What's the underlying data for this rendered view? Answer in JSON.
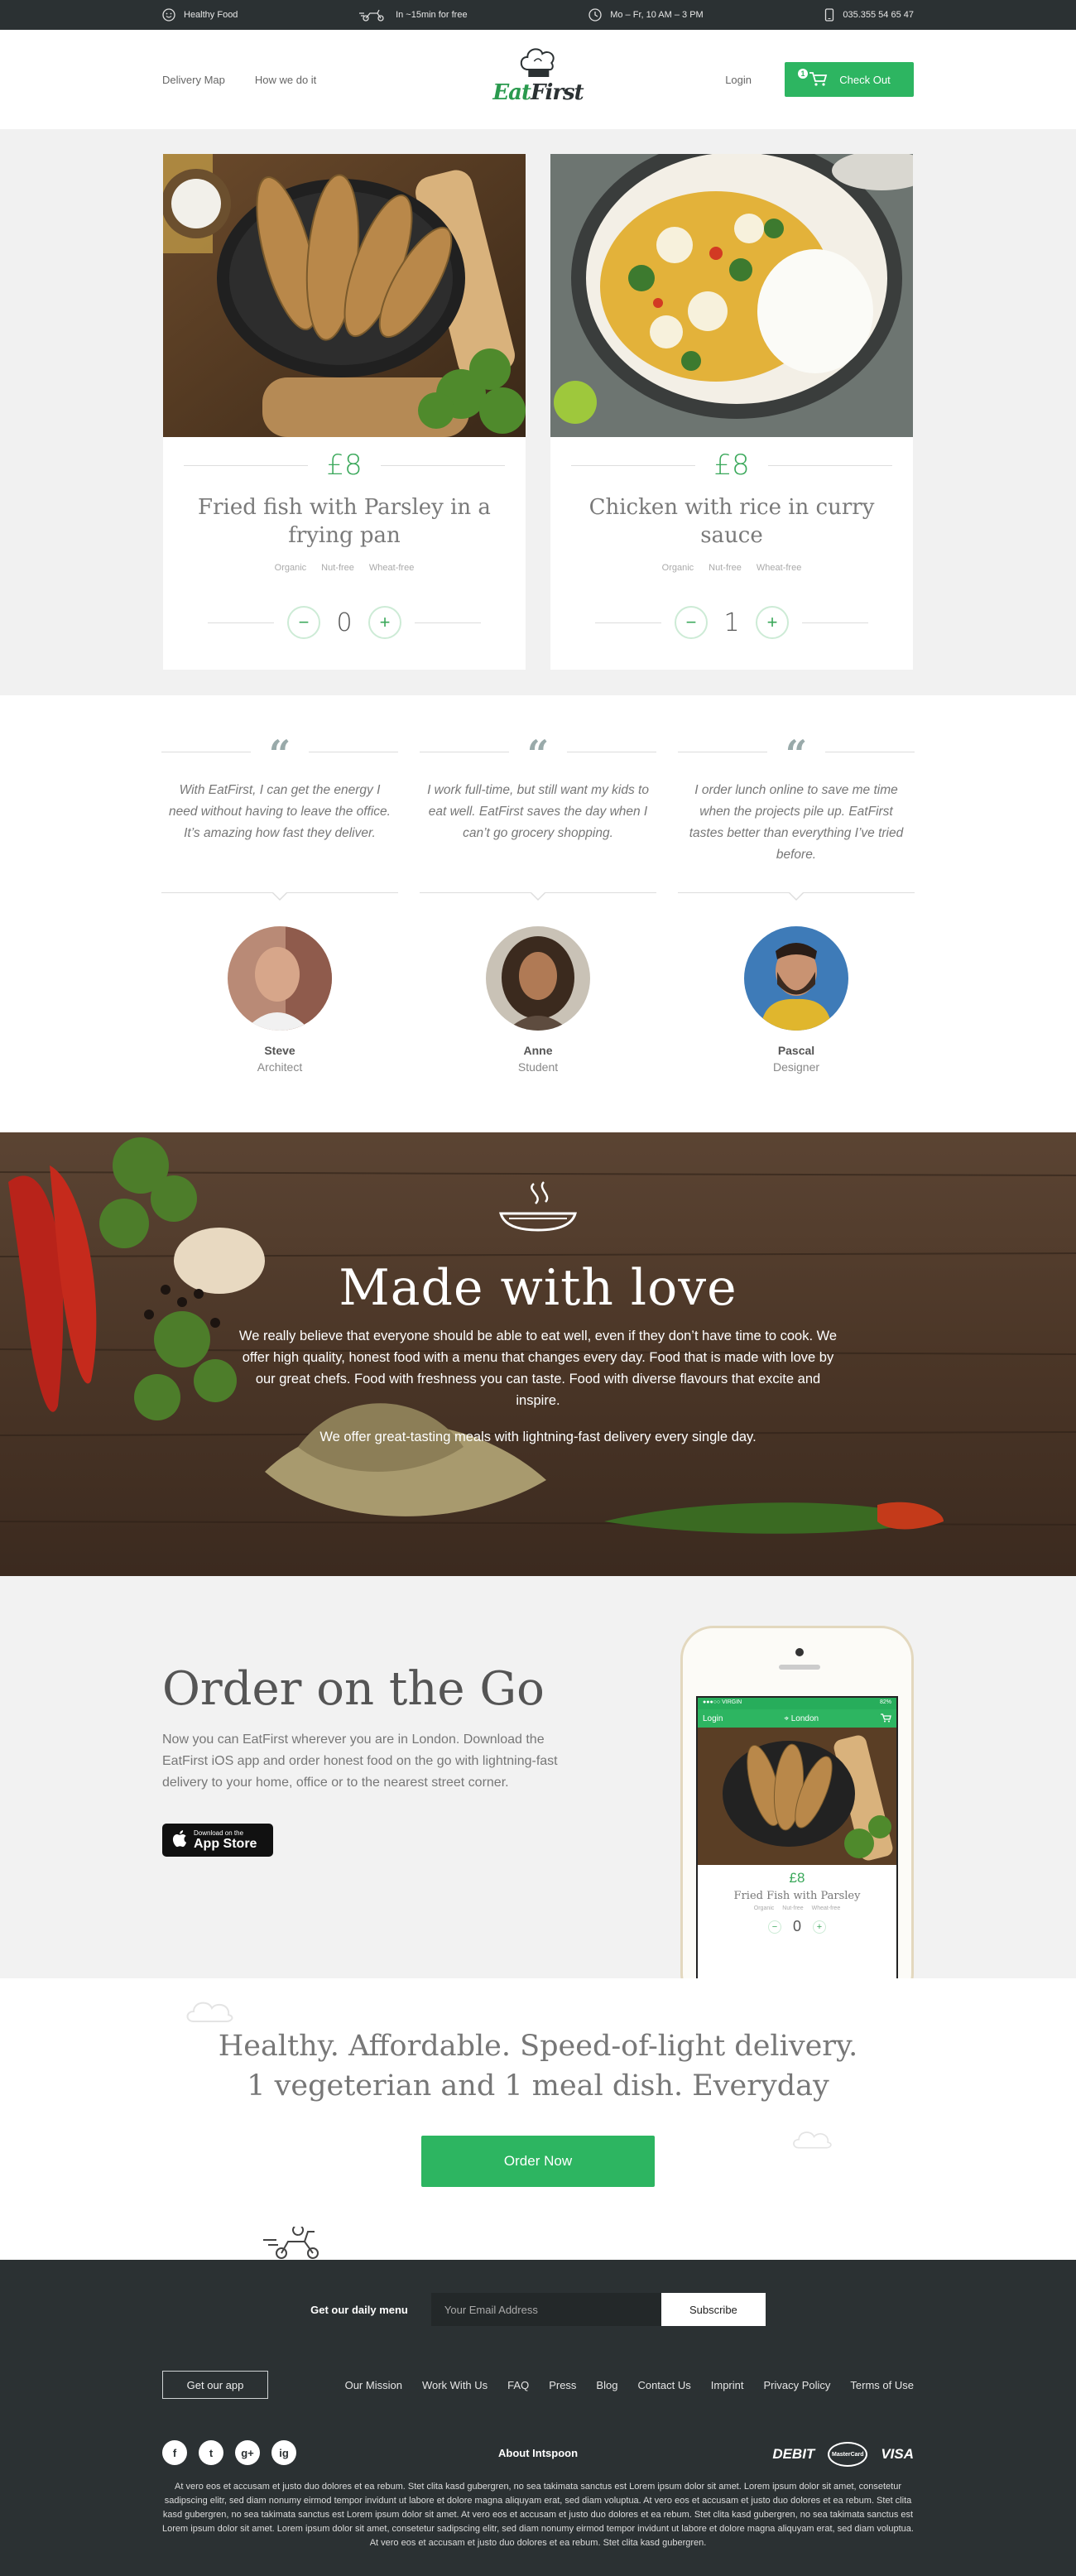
{
  "topbar": {
    "tagline": "Healthy Food",
    "delivery": "In ~15min for free",
    "hours": "Mo – Fr, 10 AM – 3 PM",
    "phone": "035.355 54 65 47"
  },
  "header": {
    "nav": [
      "Delivery Map",
      "How we do it"
    ],
    "logo_a": "Eat",
    "logo_b": "First",
    "login": "Login",
    "cart_count": "1",
    "checkout": "Check Out"
  },
  "products": [
    {
      "price": "£8",
      "title": "Fried fish with Parsley  in a frying pan",
      "tags": [
        "Organic",
        "Nut-free",
        "Wheat-free"
      ],
      "qty": "0"
    },
    {
      "price": "£8",
      "title": "Chicken with rice in curry sauce",
      "tags": [
        "Organic",
        "Nut-free",
        "Wheat-free"
      ],
      "qty": "1"
    }
  ],
  "qty_controls": {
    "minus": "−",
    "plus": "+"
  },
  "testimonials": [
    {
      "quote": "With EatFirst, I can get the energy I need without having to leave the office. It’s amazing how fast they deliver.",
      "name": "Steve",
      "role": "Architect"
    },
    {
      "quote": "I work full-time, but still want my kids to eat well. EatFirst saves the day when I can’t go grocery shopping.",
      "name": "Anne",
      "role": "Student"
    },
    {
      "quote": "I order lunch online to save me time when the projects pile up. EatFirst tastes better than everything I’ve tried before.",
      "name": "Pascal",
      "role": "Designer"
    }
  ],
  "quote_mark": "“",
  "love": {
    "title": "Made with love",
    "p1": "We really believe that everyone should be able to eat well, even if they don’t have time to cook. We offer high quality, honest food with a menu that changes every day. Food that is made with love by our great chefs. Food with freshness you can taste. Food with diverse flavours that excite and inspire.",
    "p2": "We offer great-tasting meals with lightning-fast delivery every single day."
  },
  "order": {
    "title": "Order on the Go",
    "text": "Now you can EatFirst wherever you are in London. Download the EatFirst iOS app and order honest food on the go with lightning-fast delivery to your home, office or to the nearest street corner.",
    "appstore_small": "Download on the",
    "appstore_big": "App Store",
    "phone": {
      "carrier": "●●●○○ VIRGIN",
      "battery": "82%",
      "login": "Login",
      "city": "London",
      "price": "£8",
      "title": "Fried Fish with Parsley",
      "tags": [
        "Organic",
        "Nut-free",
        "Wheat-free"
      ],
      "qty": "0"
    }
  },
  "tagline": {
    "line1": "Healthy. Affordable. Speed-of-light delivery.",
    "line2": "1 vegeterian and 1 meal dish. Everyday",
    "button": "Order Now"
  },
  "footer": {
    "newsletter_label": "Get our daily menu",
    "email_placeholder": "Your Email Address",
    "subscribe": "Subscribe",
    "get_app": "Get our app",
    "links": [
      "Our Mission",
      "Work With Us",
      "FAQ",
      "Press",
      "Blog",
      "Contact Us",
      "Imprint",
      "Privacy Policy",
      "Terms of Use"
    ],
    "about": "About Intspoon",
    "social": [
      "f",
      "t",
      "g+",
      "ig"
    ],
    "pay": [
      "DEBIT",
      "MasterCard",
      "VISA"
    ],
    "legal": "At vero eos et accusam et justo duo dolores et ea rebum. Stet clita kasd gubergren, no sea takimata sanctus est Lorem ipsum dolor sit amet. Lorem ipsum dolor sit amet, consetetur sadipscing elitr, sed diam nonumy eirmod tempor invidunt ut labore et dolore magna aliquyam erat, sed diam voluptua. At vero eos et accusam et justo duo dolores et ea rebum. Stet clita kasd gubergren, no sea takimata sanctus est Lorem ipsum dolor sit amet. At vero eos et accusam et justo duo dolores et ea rebum. Stet clita kasd gubergren, no sea takimata sanctus est Lorem ipsum dolor sit amet. Lorem ipsum dolor sit amet, consetetur sadipscing elitr, sed diam nonumy eirmod tempor invidunt ut labore et dolore magna aliquyam erat, sed diam voluptua. At vero eos et accusam et justo duo dolores et ea rebum. Stet clita kasd gubergren."
  },
  "colors": {
    "brand_green": "#2db561",
    "dark": "#2b3133",
    "light_bg": "#f1f1f1"
  }
}
